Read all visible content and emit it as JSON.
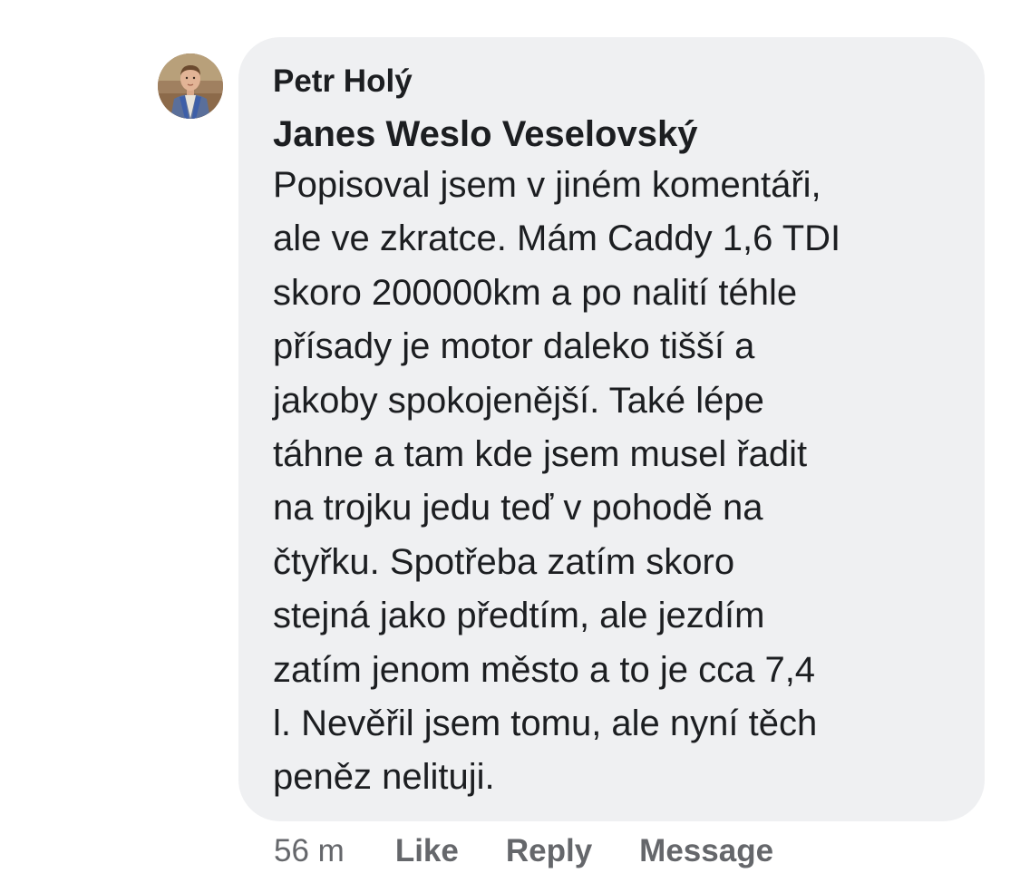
{
  "comment": {
    "author": "Petr Holý",
    "mention": "Janes Weslo Veselovský",
    "body_lines": [
      "Popisoval jsem v jiném komentáři,",
      "ale ve zkratce. Mám Caddy 1,6 TDI",
      "skoro 200000km a po nalití téhle",
      "přísady je motor daleko tišší a",
      "jakoby spokojenější. Také lépe",
      "táhne a tam kde jsem musel řadit",
      "na trojku jedu teď v pohodě na",
      "čtyřku. Spotřeba zatím skoro",
      "stejná jako předtím, ale jezdím",
      "zatím jenom město a to je cca 7,4",
      "l. Nevěřil jsem tomu, ale nyní těch",
      "peněz nelituji."
    ],
    "timestamp": "56 m",
    "actions": {
      "like": "Like",
      "reply": "Reply",
      "message": "Message"
    }
  },
  "colors": {
    "bubble_bg": "#eff0f2",
    "text": "#1c1e21",
    "meta_text": "#65676b"
  }
}
